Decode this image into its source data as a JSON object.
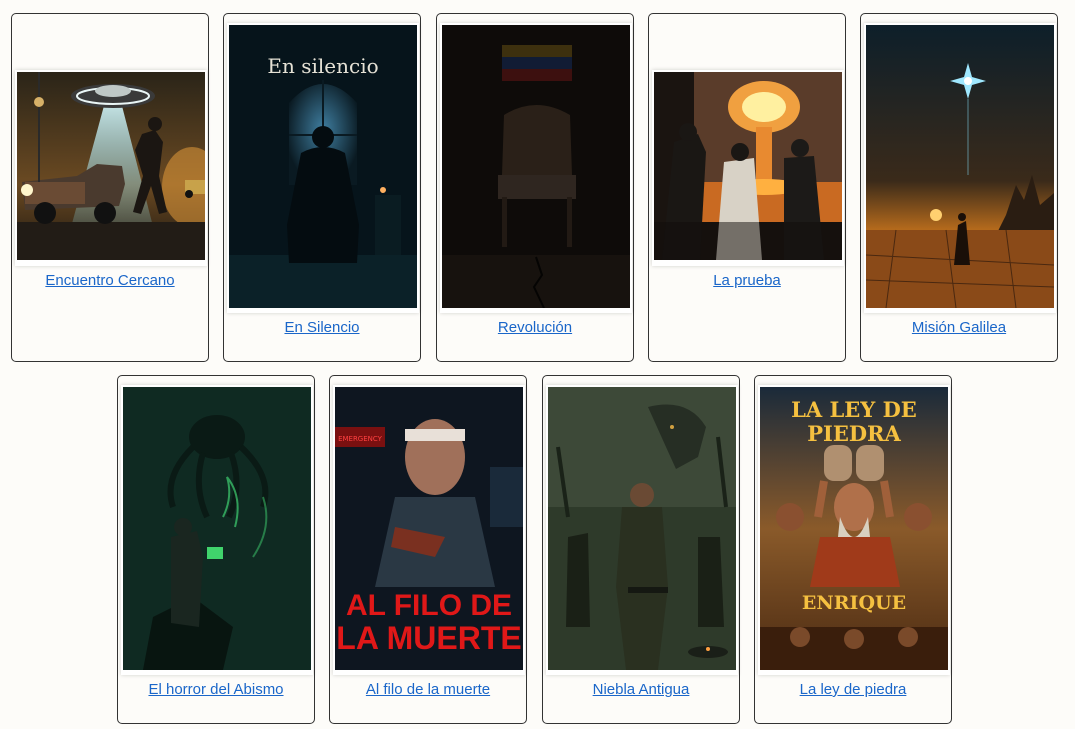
{
  "movies": [
    {
      "title": "Encuentro Cercano",
      "poster": "ufo-car-poster"
    },
    {
      "title": "En Silencio",
      "poster_text": "En silencio",
      "poster": "silhouette-window-poster"
    },
    {
      "title": "Revolución",
      "poster": "empty-chair-flag-poster"
    },
    {
      "title": "La prueba",
      "poster": "nuclear-test-poster"
    },
    {
      "title": "Misión Galilea",
      "poster": "desert-star-poster"
    },
    {
      "title": "El horror del Abismo",
      "poster": "tentacle-monster-poster"
    },
    {
      "title": "Al filo de la muerte",
      "poster_text_line1": "AL FILO DE",
      "poster_text_line2": "LA MUERTE",
      "poster_sign": "EMERGENCY",
      "poster": "injured-man-gun-poster"
    },
    {
      "title": "Niebla Antigua",
      "poster": "dinosaur-fog-poster"
    },
    {
      "title": "La ley de piedra",
      "poster_text_line1": "LA LEY DE",
      "poster_text_line2": "PIEDRA",
      "poster_name": "ENRIQUE",
      "poster": "stone-tablets-poster"
    }
  ]
}
